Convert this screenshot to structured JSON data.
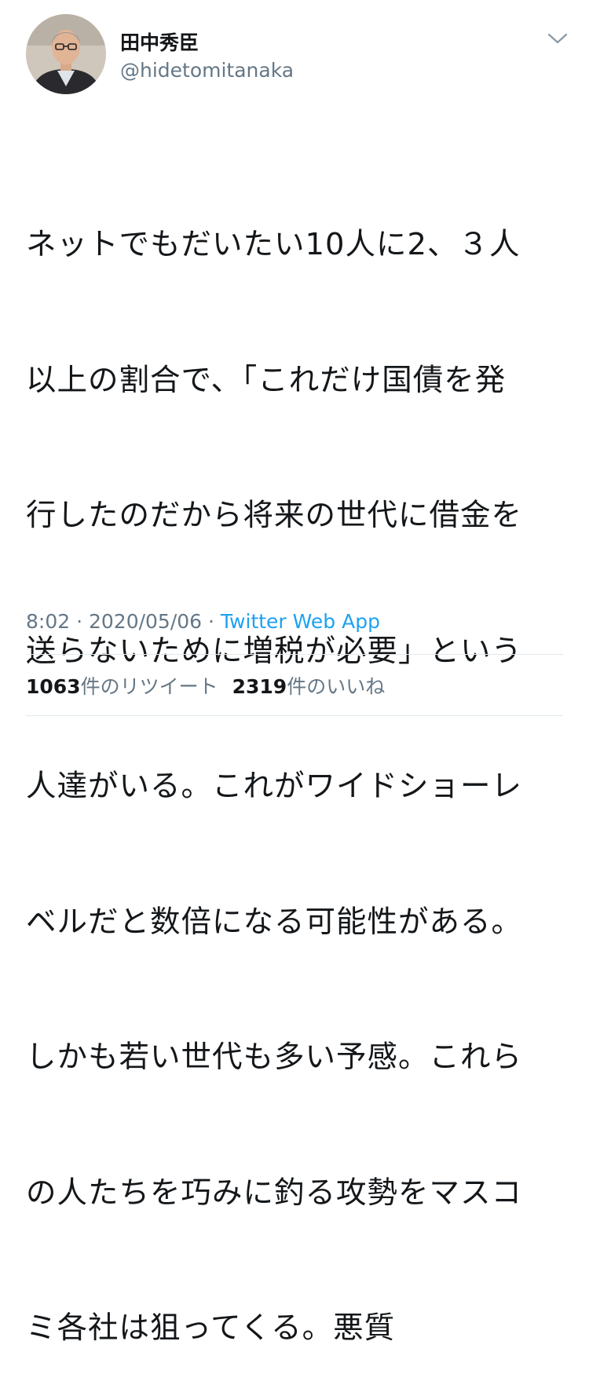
{
  "tweet": {
    "author": {
      "display_name": "田中秀臣",
      "handle": "@hidetomitanaka",
      "avatar": "profile-photo"
    },
    "text_lines": [
      "ネットでもだいたい10人に2、３人",
      "以上の割合で、「これだけ国債を発",
      "行したのだから将来の世代に借金を",
      "送らないために増税が必要」という",
      "人達がいる。これがワイドショーレ",
      "ベルだと数倍になる可能性がある。",
      "しかも若い世代も多い予感。これら",
      "の人たちを巧みに釣る攻勢をマスコ",
      "ミ各社は狙ってくる。悪質"
    ],
    "time": "8:02",
    "separator": " · ",
    "date": "2020/05/06",
    "source_app": "Twitter Web App",
    "stats": {
      "retweets_count": "1063",
      "retweets_label": "件のリツイート",
      "likes_count": "2319",
      "likes_label": "件のいいね"
    }
  },
  "icons": {
    "menu": "chevron-down-icon"
  },
  "colors": {
    "text": "#14171a",
    "secondary": "#657786",
    "link": "#1da1f2",
    "divider": "#e1e8ed"
  }
}
